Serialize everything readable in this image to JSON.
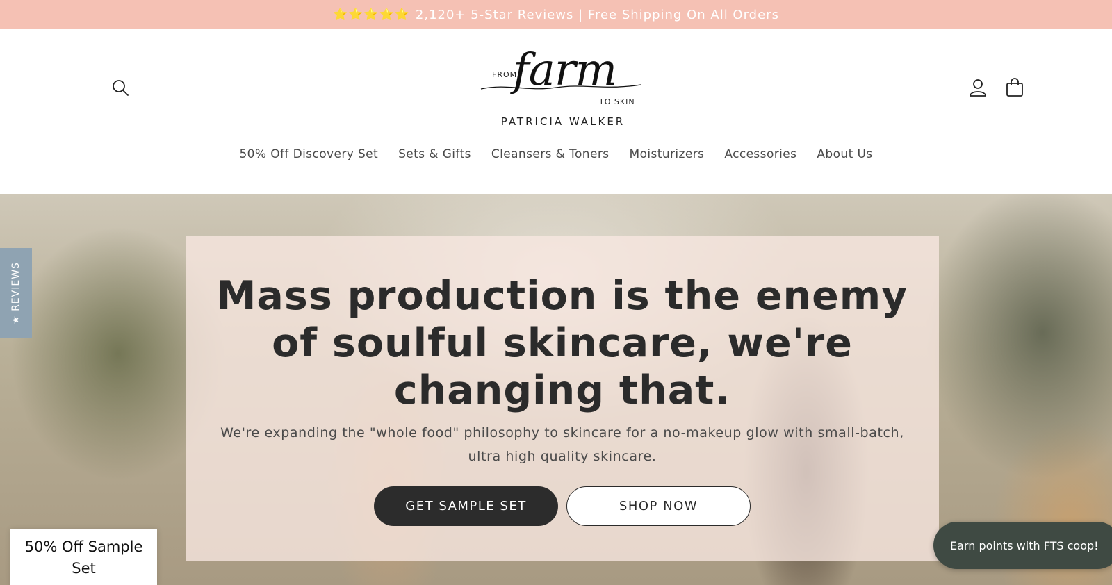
{
  "announcement": {
    "stars": "⭐⭐⭐⭐⭐",
    "text": "2,120+ 5-Star Reviews | Free Shipping On All Orders"
  },
  "header": {
    "icons": {
      "search": "search-icon",
      "account": "account-icon",
      "cart": "cart-icon"
    },
    "logo": {
      "from": "FROM",
      "script": "farm",
      "to_skin": "TO SKIN",
      "brand": "PATRICIA WALKER"
    },
    "nav": [
      {
        "label": "50% Off Discovery Set"
      },
      {
        "label": "Sets & Gifts"
      },
      {
        "label": "Cleansers & Toners"
      },
      {
        "label": "Moisturizers"
      },
      {
        "label": "Accessories"
      },
      {
        "label": "About Us"
      }
    ]
  },
  "hero": {
    "title": "Mass production is the enemy of soulful skincare, we're changing that.",
    "subtitle": "We're expanding the \"whole food\" philosophy to skincare for a no-makeup glow with small-batch, ultra high quality skincare.",
    "primary_button": "GET SAMPLE SET",
    "secondary_button": "SHOP NOW"
  },
  "widgets": {
    "reviews_tab": "★ REVIEWS",
    "sample_popup": "50% Off Sample Set",
    "points_button": "Earn points with FTS coop!"
  },
  "colors": {
    "announcement_bg": "#f5c1b4",
    "primary_button": "#2c2c2c",
    "reviews_tab": "#8fa3b2",
    "points_button": "#3f4a43"
  }
}
